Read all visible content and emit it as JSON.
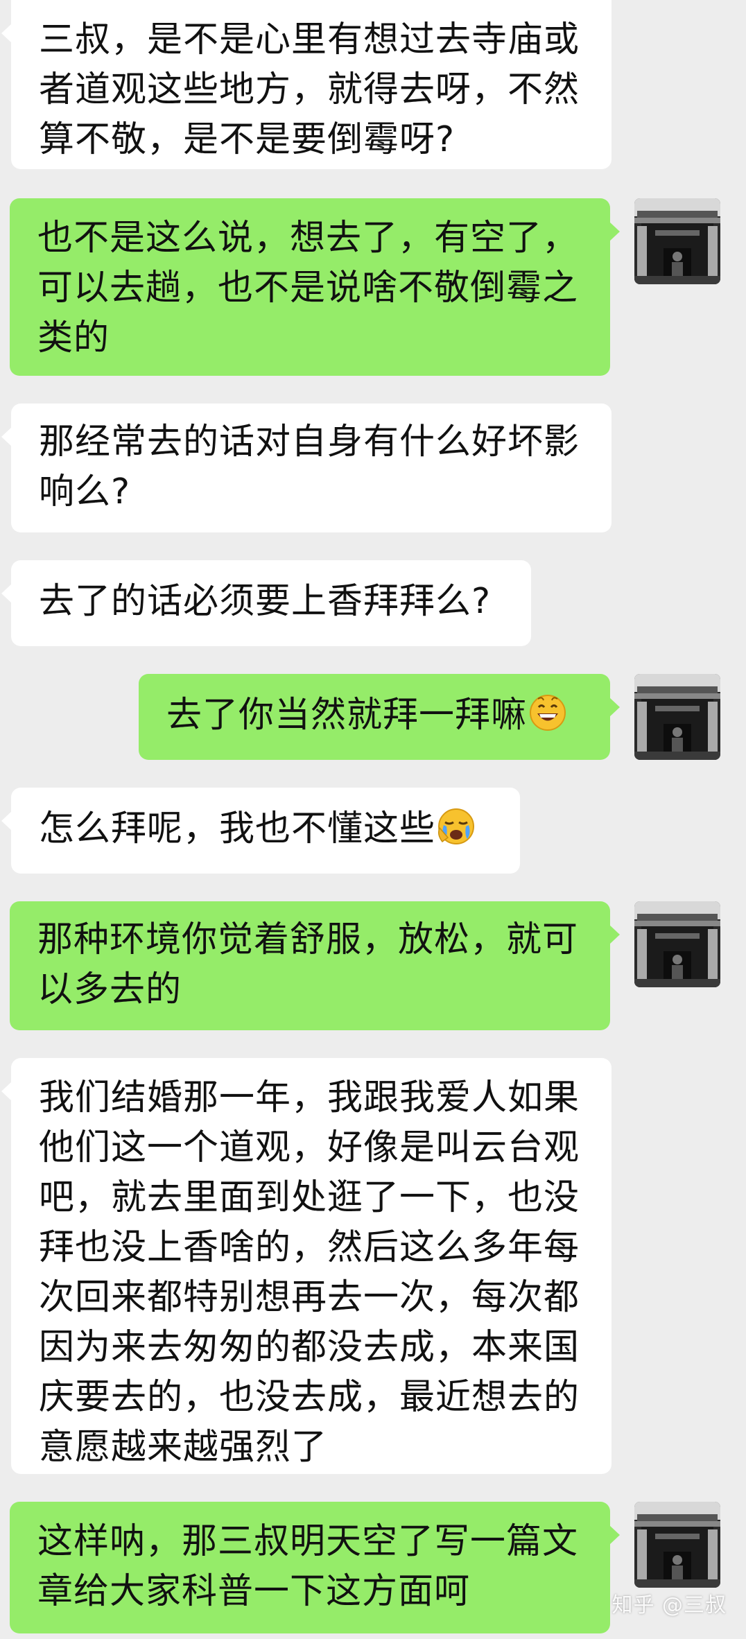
{
  "messages": [
    {
      "side": "in",
      "lines": [
        "三叔，是不是心里有想过去寺庙或",
        "者道观这些地方，就得去呀，不然",
        "算不敬，是不是要倒霉呀?"
      ]
    },
    {
      "side": "out",
      "lines": [
        "也不是这么说，想去了，有空了，",
        "可以去趟，也不是说啥不敬倒霉之",
        "类的"
      ]
    },
    {
      "side": "in",
      "lines": [
        "那经常去的话对自身有什么好坏影",
        "响么?"
      ]
    },
    {
      "side": "in",
      "lines": [
        "去了的话必须要上香拜拜么?"
      ]
    },
    {
      "side": "out",
      "lines": [
        "去了你当然就拜一拜嘛"
      ],
      "emoji": "grinning-face-emoji"
    },
    {
      "side": "in",
      "lines": [
        "怎么拜呢，我也不懂这些"
      ],
      "emoji": "crying-face-emoji"
    },
    {
      "side": "out",
      "lines": [
        "那种环境你觉着舒服，放松，就可",
        "以多去的"
      ]
    },
    {
      "side": "in",
      "lines": [
        "我们结婚那一年，我跟我爱人如果",
        "他们这一个道观，好像是叫云台观",
        "吧，就去里面到处逛了一下，也没",
        "拜也没上香啥的，然后这么多年每",
        "次回来都特别想再去一次，每次都",
        "因为来去匆匆的都没去成，本来国",
        "庆要去的，也没去成，最近想去的",
        "意愿越来越强烈了"
      ]
    },
    {
      "side": "out",
      "lines": [
        "这样呐，那三叔明天空了写一篇文",
        "章给大家科普一下这方面呵"
      ]
    }
  ],
  "watermark": "知乎 @三叔",
  "colors": {
    "background": "#ededed",
    "incoming_bubble": "#ffffff",
    "outgoing_bubble": "#95ec69",
    "text": "#111111"
  },
  "avatar_icon": "temple-photo-avatar"
}
